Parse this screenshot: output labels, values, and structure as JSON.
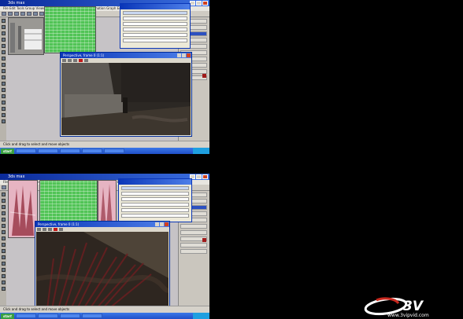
{
  "app_title": "3ds max",
  "menu": "File  Edit  Tools  Group  Views  Create  Modifiers  Character  Animation  Graph Editors  Rendering  Customize",
  "render_window_title": "Perspective, frame 0 (1:1)",
  "status_text": "Click and drag to select and move objects",
  "taskbar": {
    "start_label": "start"
  },
  "watermark": {
    "text": "www.3vipvid.com",
    "logo_letters": "3V"
  },
  "colors": {
    "title_bar": "#0a36b8",
    "taskbar": "#2a5fd8",
    "panel_highlight": "#2c50c0",
    "viewport_grid": "#51c456",
    "watermark_red": "#c8281e"
  },
  "icons": [
    "close-icon",
    "minimize-icon",
    "maximize-icon",
    "tool-icon",
    "render-icon"
  ]
}
